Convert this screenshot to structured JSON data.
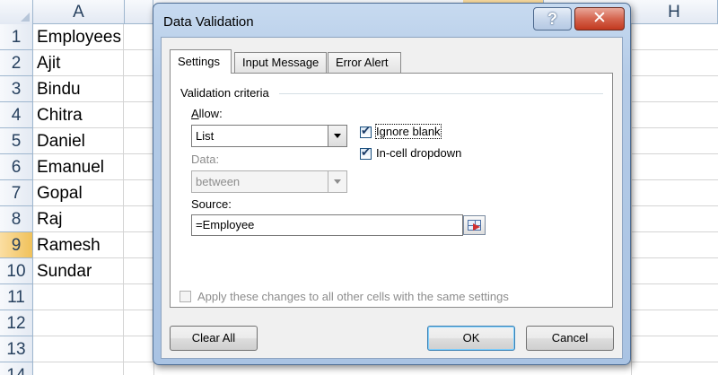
{
  "sheet": {
    "columns": {
      "a": "A",
      "h": "H"
    },
    "rows": [
      {
        "num": "1",
        "value": "Employees"
      },
      {
        "num": "2",
        "value": "Ajit"
      },
      {
        "num": "3",
        "value": "Bindu"
      },
      {
        "num": "4",
        "value": "Chitra"
      },
      {
        "num": "5",
        "value": "Daniel"
      },
      {
        "num": "6",
        "value": "Emanuel"
      },
      {
        "num": "7",
        "value": "Gopal"
      },
      {
        "num": "8",
        "value": "Raj"
      },
      {
        "num": "9",
        "value": "Ramesh"
      },
      {
        "num": "10",
        "value": "Sundar"
      },
      {
        "num": "11",
        "value": ""
      },
      {
        "num": "12",
        "value": ""
      },
      {
        "num": "13",
        "value": ""
      },
      {
        "num": "14",
        "value": ""
      }
    ],
    "selected_row": "9"
  },
  "dialog": {
    "title": "Data Validation",
    "help_glyph": "?",
    "close_glyph": "✕",
    "tabs": [
      {
        "label": "Settings",
        "active": true
      },
      {
        "label": "Input Message",
        "active": false
      },
      {
        "label": "Error Alert",
        "active": false
      }
    ],
    "validation_criteria_label": "Validation criteria",
    "allow": {
      "label": "Allow:",
      "value": "List"
    },
    "data": {
      "label": "Data:",
      "value": "between"
    },
    "ignore_blank": {
      "label": "Ignore blank",
      "checked": true
    },
    "in_cell_dropdown": {
      "label": "In-cell dropdown",
      "checked": true
    },
    "source": {
      "label": "Source:",
      "value": "=Employee"
    },
    "apply_all": {
      "label": "Apply these changes to all other cells with the same settings",
      "checked": false
    },
    "buttons": {
      "clear_all": "Clear All",
      "ok": "OK",
      "cancel": "Cancel"
    }
  },
  "colors": {
    "dialog_frame": "#b4cbe7",
    "close_button": "#c2391f",
    "selected_header": "#f1c15f",
    "header_text": "#27415f"
  }
}
